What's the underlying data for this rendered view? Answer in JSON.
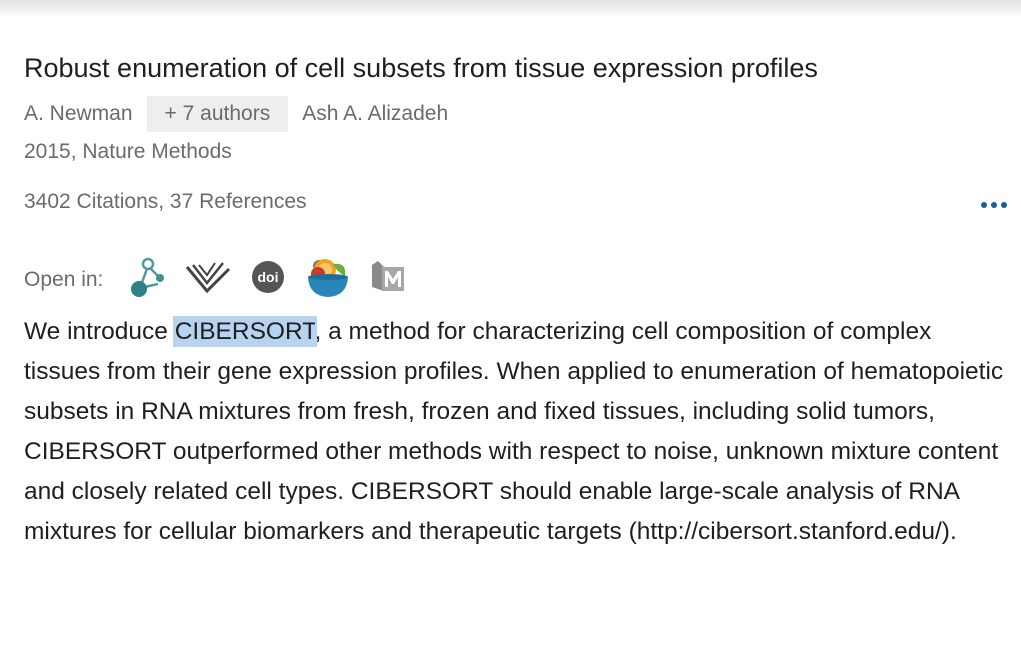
{
  "paper": {
    "title": "Robust enumeration of cell subsets from tissue expression profiles",
    "first_author": "A. Newman",
    "more_authors": "+ 7 authors",
    "last_author": "Ash A. Alizadeh",
    "year_venue": "2015, Nature Methods",
    "counts": "3402 Citations, 37 References"
  },
  "open_in": {
    "label": "Open in:",
    "icons": [
      "molecule-network-icon",
      "semantic-scholar-icon",
      "doi-icon",
      "unpaywall-bowl-icon",
      "mendeley-icon"
    ],
    "doi_text": "doi"
  },
  "abstract": {
    "before": "We introduce ",
    "highlight": "CIBERSORT",
    "after": ", a method for characterizing cell composition of complex tissues from their gene expression profiles. When applied to enumeration of hematopoietic subsets in RNA mixtures from fresh, frozen and fixed tissues, including solid tumors, CIBERSORT outperformed other methods with respect to noise, unknown mixture content and closely related cell types. CIBERSORT should enable large-scale analysis of RNA mixtures for cellular biomarkers and therapeutic targets (http://cibersort.stanford.edu/)."
  },
  "colors": {
    "accent": "#1b5e9a",
    "highlight": "#b7d3f0",
    "meta_text": "#6b6b6b"
  }
}
